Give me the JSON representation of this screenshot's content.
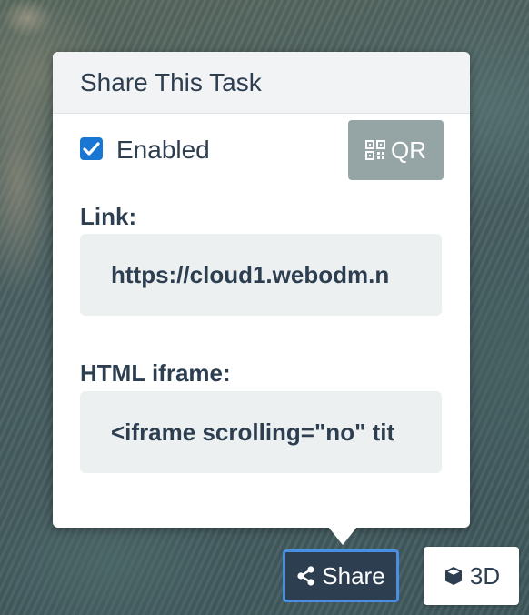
{
  "popup": {
    "title": "Share This Task",
    "enabled_label": "Enabled",
    "enabled_checked": true,
    "qr_label": "QR",
    "qr_icon": "qr-code-icon",
    "link_label": "Link:",
    "link_value": "https://cloud1.webodm.n",
    "iframe_label": "HTML iframe:",
    "iframe_value": "<iframe scrolling=\"no\" tit"
  },
  "toolbar": {
    "share_label": "Share",
    "share_icon": "share-icon",
    "view3d_label": "3D",
    "view3d_icon": "cube-icon"
  },
  "colors": {
    "primary_dark": "#2c3e50",
    "focus_ring": "#4a90e2",
    "checkbox": "#1976d2",
    "qr_button": "#95a5a6",
    "field_bg": "#ecf0f1"
  }
}
